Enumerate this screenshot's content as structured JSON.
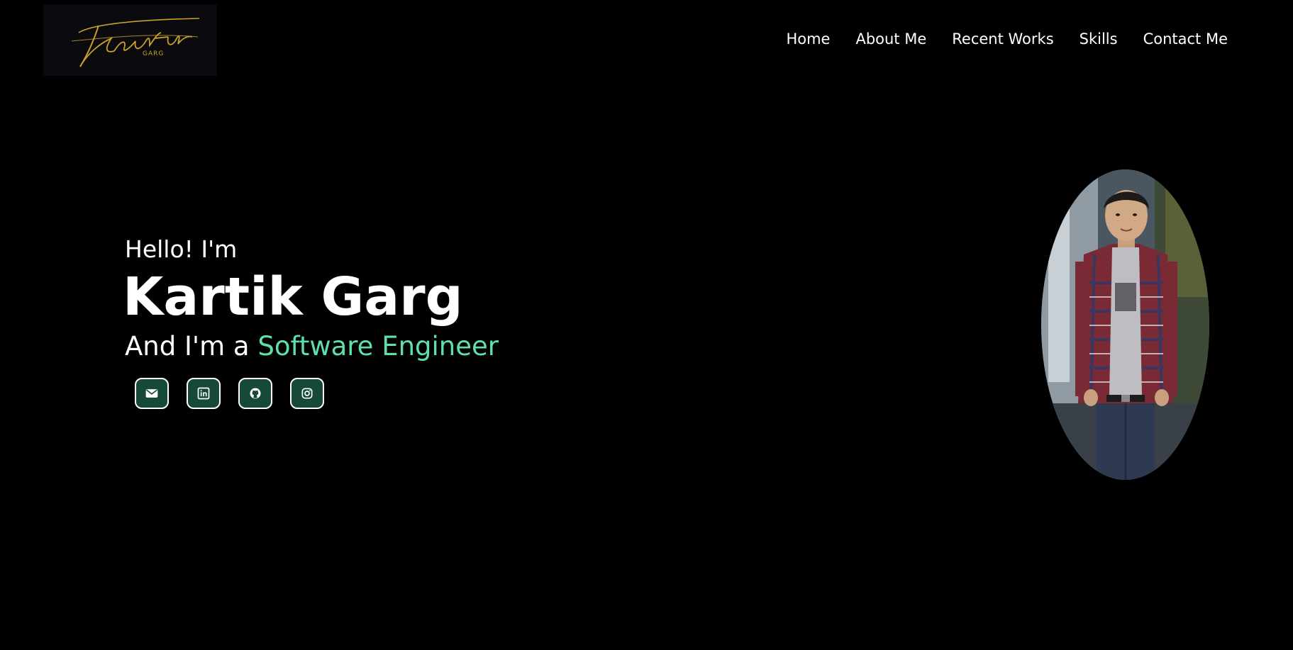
{
  "header": {
    "logo_script": "Kartik",
    "logo_sub": "GARG",
    "nav": [
      "Home",
      "About Me",
      "Recent Works",
      "Skills",
      "Contact Me"
    ]
  },
  "hero": {
    "greeting": "Hello! I'm",
    "name": "Kartik Garg",
    "role_prefix": "And I'm a ",
    "role_highlight": "Software Engineer"
  },
  "socials": [
    {
      "icon": "mail-icon"
    },
    {
      "icon": "linkedin-icon"
    },
    {
      "icon": "github-icon"
    },
    {
      "icon": "instagram-icon"
    }
  ],
  "colors": {
    "background": "#000000",
    "accent": "#5ee0a7",
    "social_bg": "#174a36",
    "logo_gold": "#c9a227"
  }
}
